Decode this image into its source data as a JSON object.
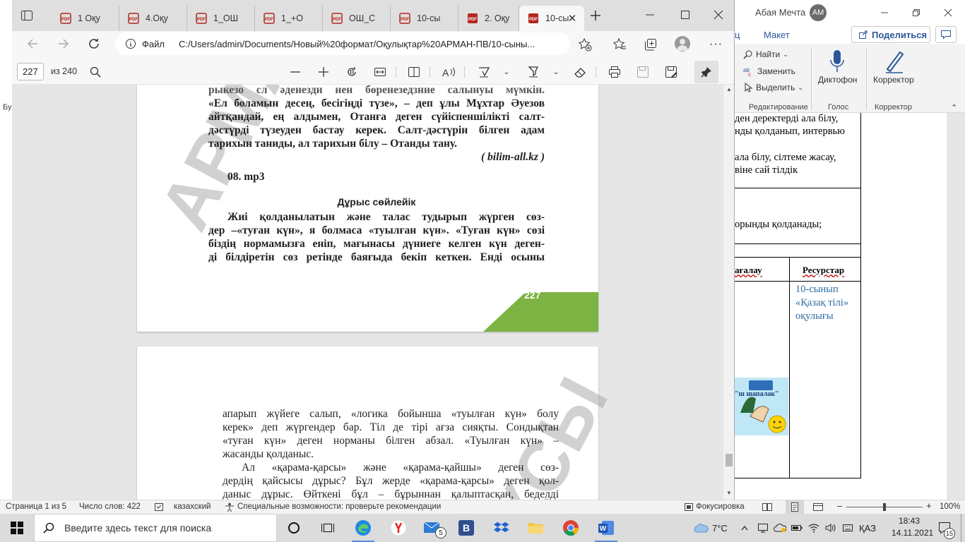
{
  "edge": {
    "tabs": [
      {
        "label": "1 Оқу"
      },
      {
        "label": "4.Оқу"
      },
      {
        "label": "1_ОШ"
      },
      {
        "label": "1_+О"
      },
      {
        "label": "ОШ_С"
      },
      {
        "label": "10-сы"
      },
      {
        "label": "2. Оқу"
      },
      {
        "label": "10-сы",
        "active": true
      }
    ],
    "address": {
      "scheme_label": "Файл",
      "url": "C:/Users/admin/Documents/Новый%20формат/Оқулықтар%20АРМАН-ПВ/10-сыны..."
    },
    "pdf_toolbar": {
      "page_current": "227",
      "page_total": "из 240"
    }
  },
  "pdf": {
    "page_top": {
      "lines": [
        "рыкезо сл әденездн нен бөренезедзнне салынуы мүмкін.",
        "«Ел боламын десең, бесігіңді түзе», – деп ұлы Мұхтар Әуезов",
        "айтқандай, ең алдымен, Отанға деген сүйіспеншілікті салт-",
        "дәстүрді түзеуден бастау керек. Салт-дәстүрін білген адам",
        "тарихын таниды, ал тарихын білу – Отанды тану."
      ],
      "source": "( bilim-all.kz )",
      "audio": "08. mp3",
      "heading": "Дұрыс сөйлейік",
      "body_lines": [
        "Жиі қолданылатын және талас тудырып жүрген сөз-",
        "дер –«туған күн», я болмаса «туылған күн». «Туған күн» сөзі",
        "біздің нормамызға еніп, мағынасы дүниеге келген күн деген-",
        "ді білдіретін сөз ретінде баяғыда бекіп кеткен. Енді осыны"
      ],
      "page_number": "227",
      "watermark": "АРМАН"
    },
    "page_bottom": {
      "lines": [
        "апарып жүйеге салып, «логика бойынша «туылған күн» болу",
        "керек» деп жүргендер бар. Тіл де тірі ағза сияқты. Сондықтан",
        "«туған күн» деген норманы білген абзал. «Туылған күн» –",
        "жасанды қолданыс."
      ],
      "lines2": [
        "Ал «қарама-қарсы» және «қарама-қайшы» деген сөз-",
        "дердің қайсысы дұрыс? Бұл жерде «қарама-қарсы» деген қол-",
        "даныс дұрыс. Өйткені бұл – бұрыннан қалыптасқан, беделді"
      ],
      "watermark": "ҚСЫ"
    }
  },
  "word": {
    "account_name": "Абая Мечта",
    "account_initials": "АМ",
    "ribbon_tab_partial": "ц",
    "ribbon_tab_layout": "Макет",
    "share_label": "Поделиться",
    "editing": {
      "find": "Найти",
      "replace": "Заменить",
      "select": "Выделить",
      "group": "Редактирование"
    },
    "voice": {
      "label": "Диктофон",
      "group": "Голос"
    },
    "editor": {
      "label": "Корректор",
      "group": "Корректор"
    },
    "left_cut_text": "Бу",
    "doc": {
      "lines_block1": [
        "ден деректерді ала білу,",
        "нды қолданып, интервью"
      ],
      "lines_block2": [
        "ала білу, сілтеме жасау,",
        "віне сай тілдік"
      ],
      "line_block3": "орынды қолданады;",
      "col_header_left": "ағалау",
      "col_header_right": "Ресурстар",
      "resource_lines": [
        "10-сынып",
        "«Қазақ тілі»",
        "оқулығы"
      ],
      "image_caption": "\"ш шапалак\""
    }
  },
  "statusbar": {
    "page": "Страница 1 из 5",
    "words": "Число слов: 422",
    "language": "казахский",
    "accessibility": "Специальные возможности: проверьте рекомендации",
    "focus": "Фокусировка",
    "zoom": "100%"
  },
  "taskbar": {
    "search_placeholder": "Введите здесь текст для поиска",
    "mail_badge": "5",
    "weather": "7°C",
    "lang": "ҚАЗ",
    "time": "18:43",
    "date": "14.11.2021",
    "notif_count": "15"
  }
}
